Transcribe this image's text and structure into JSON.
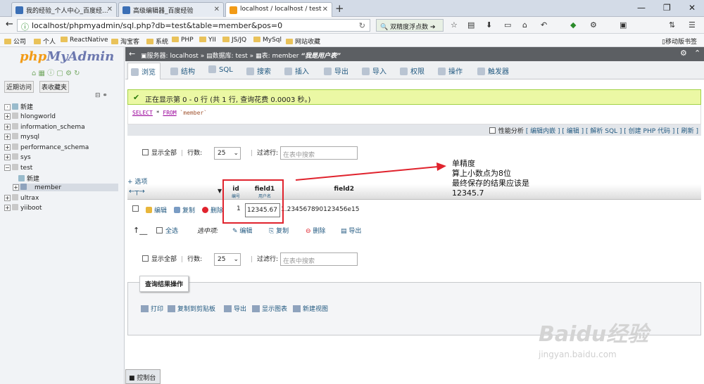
{
  "browser": {
    "tabs": [
      {
        "label": "我的经验_个人中心_百度经..."
      },
      {
        "label": "高级编辑器_百度经验"
      },
      {
        "label": "localhost / localhost / test"
      }
    ],
    "url": "localhost/phpmyadmin/sql.php?db=test&table=member&pos=0",
    "search_engine": "双精度浮点数",
    "bookmarks": [
      "公司",
      "个人",
      "ReactNative",
      "淘宝客",
      "系统",
      "PHP",
      "YII",
      "JS/JQ",
      "MySql",
      "网站收藏"
    ],
    "mobile_bookmarks": "移动版书签"
  },
  "sidebar": {
    "logo_php": "php",
    "logo_myadmin": "MyAdmin",
    "recent": "近期访问",
    "favorites": "表收藏夹",
    "tree": [
      {
        "label": "新建"
      },
      {
        "label": "hlongworld"
      },
      {
        "label": "information_schema"
      },
      {
        "label": "mysql"
      },
      {
        "label": "performance_schema"
      },
      {
        "label": "sys"
      },
      {
        "label": "test"
      },
      {
        "label": "新建"
      },
      {
        "label": "member"
      },
      {
        "label": "ultrax"
      },
      {
        "label": "yiiboot"
      }
    ]
  },
  "breadcrumb": {
    "server_label": "服务器:",
    "server": "localhost",
    "db_label": "数据库:",
    "db": "test",
    "table_label": "表:",
    "table": "member",
    "comment": "“我是用户表”"
  },
  "tabs": [
    "浏览",
    "结构",
    "SQL",
    "搜索",
    "插入",
    "导出",
    "导入",
    "权限",
    "操作",
    "触发器"
  ],
  "success_msg": "正在显示第 0 - 0 行 (共 1 行, 查询花费 0.0003 秒。)",
  "sql": {
    "select": "SELECT",
    "star": "*",
    "from": "FROM",
    "table": "`member`"
  },
  "profiling": {
    "label": "性能分析",
    "links": "[ 编辑内嵌 ] [ 编辑 ] [ 解析 SQL ] [ 创建 PHP 代码 ] [ 刷新 ]"
  },
  "nav": {
    "show_all": "显示全部",
    "rows_label": "行数:",
    "rows_value": "25",
    "filter_label": "过滤行:",
    "filter_placeholder": "在表中搜索"
  },
  "options": "+ 选项",
  "columns": [
    {
      "name": "id",
      "comment": "编号"
    },
    {
      "name": "field1",
      "comment": "用户名"
    },
    {
      "name": "field2",
      "comment": ""
    }
  ],
  "row": {
    "edit": "编辑",
    "copy": "复制",
    "delete": "删除",
    "id": "1",
    "field1": "12345.67",
    "field2": "1.234567890123456e15"
  },
  "bulk": {
    "check_all": "全选",
    "with_selected": "选中项:",
    "edit": "编辑",
    "copy": "复制",
    "delete": "删除",
    "export": "导出"
  },
  "query_ops": {
    "legend": "查询结果操作",
    "print": "打印",
    "copy": "复制到剪贴板",
    "export": "导出",
    "chart": "显示图表",
    "view": "新建视图"
  },
  "console": "控制台",
  "annotation": [
    "单精度",
    "算上小数点为8位",
    "最终保存的结果应该是",
    "12345.7"
  ],
  "watermark": {
    "main": "Baidu经验",
    "sub": "jingyan.baidu.com"
  },
  "colors": {
    "accent": "#235a81",
    "success_bg": "#ebf8a4",
    "annotation_red": "#e0232d"
  }
}
